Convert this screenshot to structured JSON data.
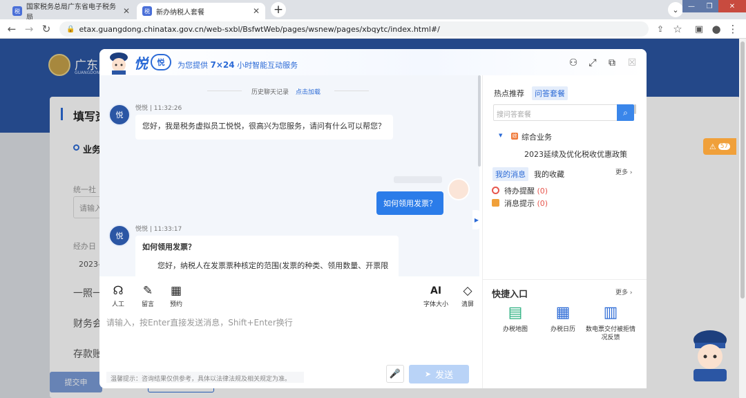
{
  "browser": {
    "tabs": [
      {
        "label": "国家税务总局广东省电子税务局",
        "active": false
      },
      {
        "label": "新办纳税人套餐",
        "active": true
      }
    ],
    "url": "etax.guangdong.chinatax.gov.cn/web-sxbl/BsfwtWeb/pages/wsnew/pages/xbqytc/index.html#/"
  },
  "page": {
    "brand": "广东",
    "brand_sub": "GUANGDONG",
    "section_title": "填写资",
    "subsection": "业务",
    "label1": "统一社",
    "input_placeholder": "请输入",
    "label2": "经办日",
    "date_value": "2023-",
    "link1": "一照一",
    "link2": "财务会",
    "link3": "存款账",
    "submit": "提交申"
  },
  "badge": {
    "count": "57"
  },
  "dialog": {
    "logo": "悦",
    "logo_badge": "悦",
    "slogan_pre": "为您提供 ",
    "slogan_bold": "7×24",
    "slogan_post": " 小时智能互动服务",
    "history_label": "历史聊天记录",
    "history_link": "点击加载",
    "messages": [
      {
        "sender": "悦悦",
        "time": "11:32:26",
        "text": "您好，我是税务虚拟员工悦悦，很高兴为您服务，请问有什么可以帮您？"
      },
      {
        "user_text": "如何领用发票？"
      },
      {
        "sender": "悦悦",
        "time": "11:33:17",
        "title": "如何领用发票？",
        "text": "您好，纳税人在发票票种核定的范围(发票的种类、领用数量、开票限"
      }
    ],
    "tools": [
      {
        "label": "人工",
        "icon": "headset-icon"
      },
      {
        "label": "留言",
        "icon": "edit-icon"
      },
      {
        "label": "预约",
        "icon": "calendar-icon"
      }
    ],
    "tools_right": [
      {
        "label": "字体大小",
        "icon": "font-size-icon"
      },
      {
        "label": "清屏",
        "icon": "eraser-icon"
      }
    ],
    "input_placeholder": "请输入，按Enter直接发送消息，Shift+Enter换行",
    "tip": "温馨提示：咨询结果仅供参考，具体以法律法规及相关规定为准。",
    "send": "发送"
  },
  "right": {
    "tabs": [
      "热点推荐",
      "问答套餐"
    ],
    "search_placeholder": "搜问答套餐",
    "category": "综合业务",
    "item": "2023延续及优化税收优惠政策",
    "msg_tabs": [
      "我的消息",
      "我的收藏"
    ],
    "more": "更多",
    "messages": [
      {
        "label": "待办提醒",
        "count": "(0)"
      },
      {
        "label": "消息提示",
        "count": "(0)"
      }
    ],
    "quick_title": "快捷入口",
    "quick_more": "更多",
    "quick": [
      {
        "label": "办税地图"
      },
      {
        "label": "办税日历"
      },
      {
        "label": "数电票交付被拒情况反馈"
      }
    ]
  },
  "colors": {
    "accent": "#2b6ad6",
    "header": "#2b56a4",
    "send_disabled": "#b9d3f7",
    "badge": "#f0a03a"
  }
}
